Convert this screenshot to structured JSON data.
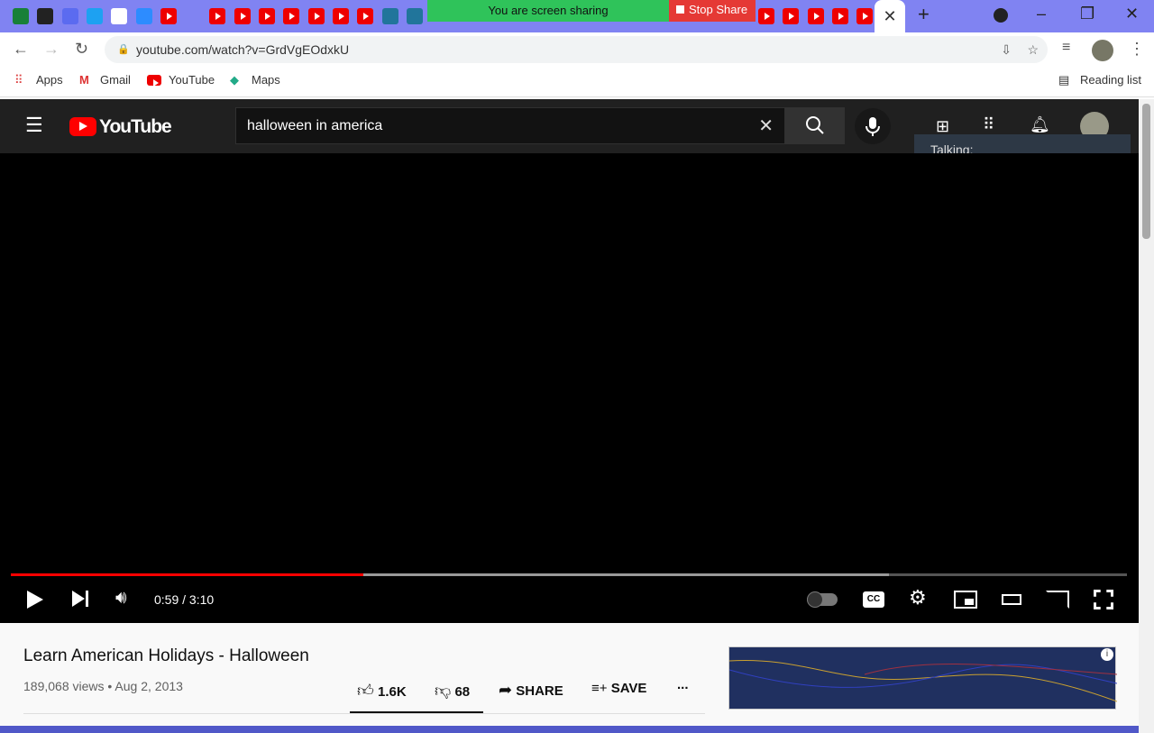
{
  "browser": {
    "tab_icons": [
      "google-sheets",
      "skype",
      "quora",
      "twitter",
      "app",
      "zoom",
      "youtube",
      "weebly",
      "youtube",
      "youtube",
      "youtube",
      "youtube",
      "youtube",
      "youtube",
      "youtube",
      "wordpress",
      "wordpress"
    ],
    "right_tab_icons": [
      "youtube",
      "youtube",
      "youtube",
      "youtube",
      "youtube"
    ],
    "screen_share_text": "You are screen sharing",
    "stop_share_label": "Stop Share",
    "url": "youtube.com/watch?v=GrdVgEOdxkU",
    "bookmarks": [
      "Apps",
      "Gmail",
      "YouTube",
      "Maps"
    ],
    "reading_list": "Reading list"
  },
  "youtube": {
    "logo": "YouTube",
    "search_value": "halloween in america",
    "talking_label": "Talking:",
    "time": "0:59 / 3:10",
    "played_fraction": 0.316,
    "buffered_fraction": 0.787,
    "video_title": "Learn American Holidays - Halloween",
    "views_date": "189,068 views • Aug 2, 2013",
    "likes": "1.6K",
    "dislikes": "68",
    "share_label": "SHARE",
    "save_label": "SAVE",
    "more_label": "..."
  }
}
